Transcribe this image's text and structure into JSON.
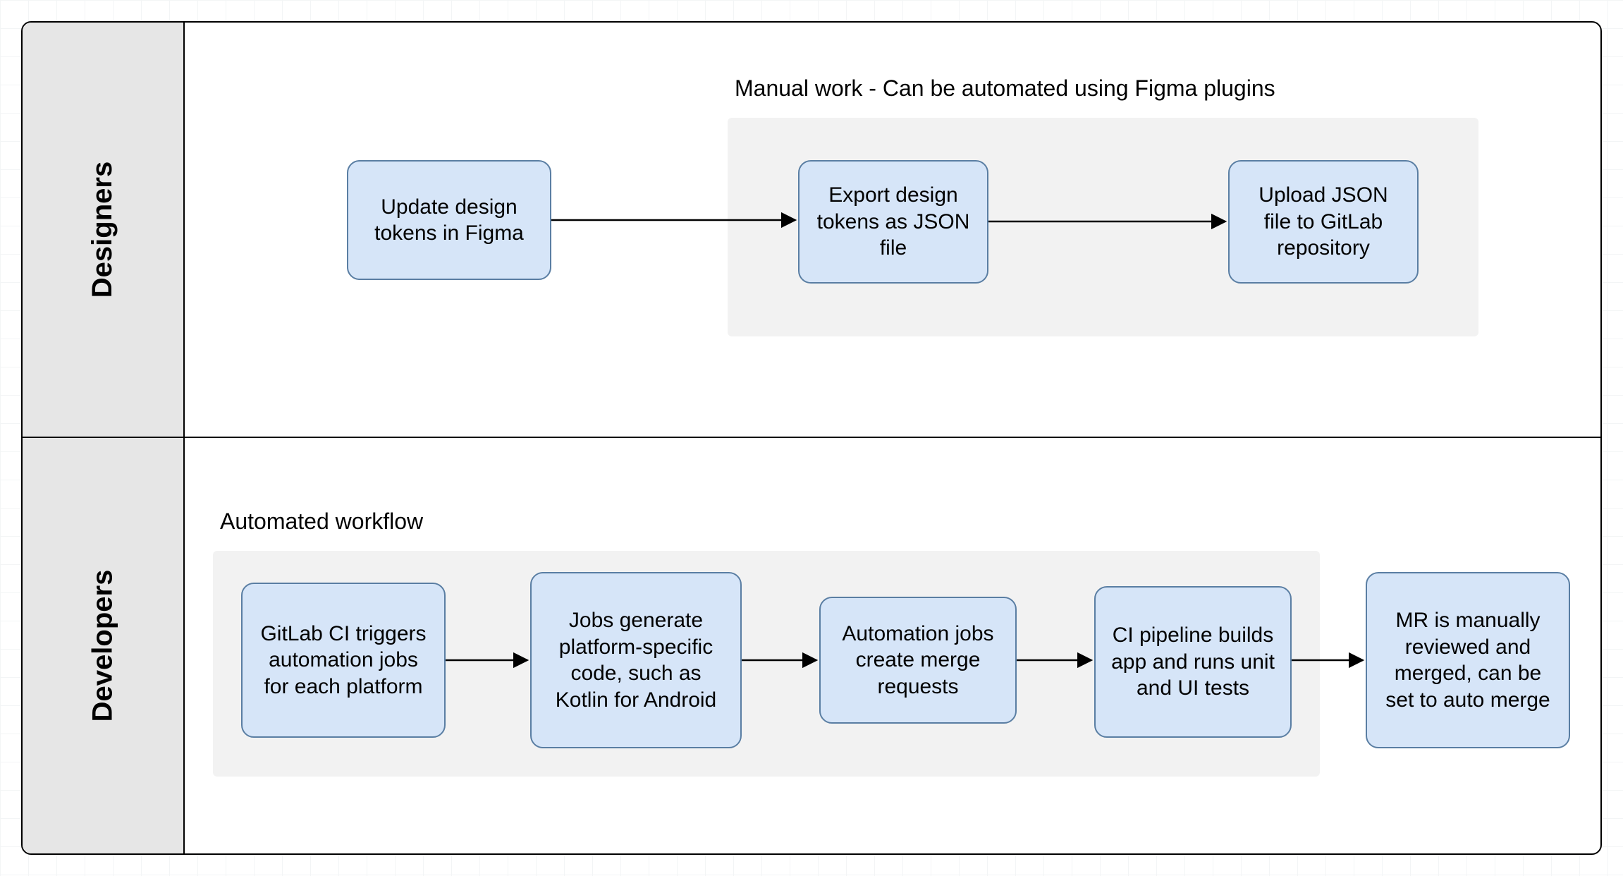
{
  "colors": {
    "node_fill": "#d6e5f8",
    "node_stroke": "#5a7ea3",
    "lane_fill": "#e6e6e6",
    "group_fill": "#f2f2f2",
    "edge": "#000000"
  },
  "lanes": {
    "designers": {
      "label": "Designers"
    },
    "developers": {
      "label": "Developers"
    }
  },
  "groups": {
    "manual": {
      "title": "Manual work - Can be automated using Figma plugins"
    },
    "automated": {
      "title": "Automated workflow"
    }
  },
  "nodes": {
    "d_update": "Update design tokens in Figma",
    "d_export": "Export design tokens as JSON file",
    "d_upload": "Upload JSON file to GitLab repository",
    "v_ci_trigger": "GitLab CI triggers automation jobs for each platform",
    "v_generate": "Jobs generate platform-specific code, such as Kotlin for Android",
    "v_create_mr": "Automation jobs create merge requests",
    "v_pipeline": "CI pipeline builds app and runs unit and UI tests",
    "v_review": "MR is manually reviewed and merged, can be set to auto merge"
  }
}
